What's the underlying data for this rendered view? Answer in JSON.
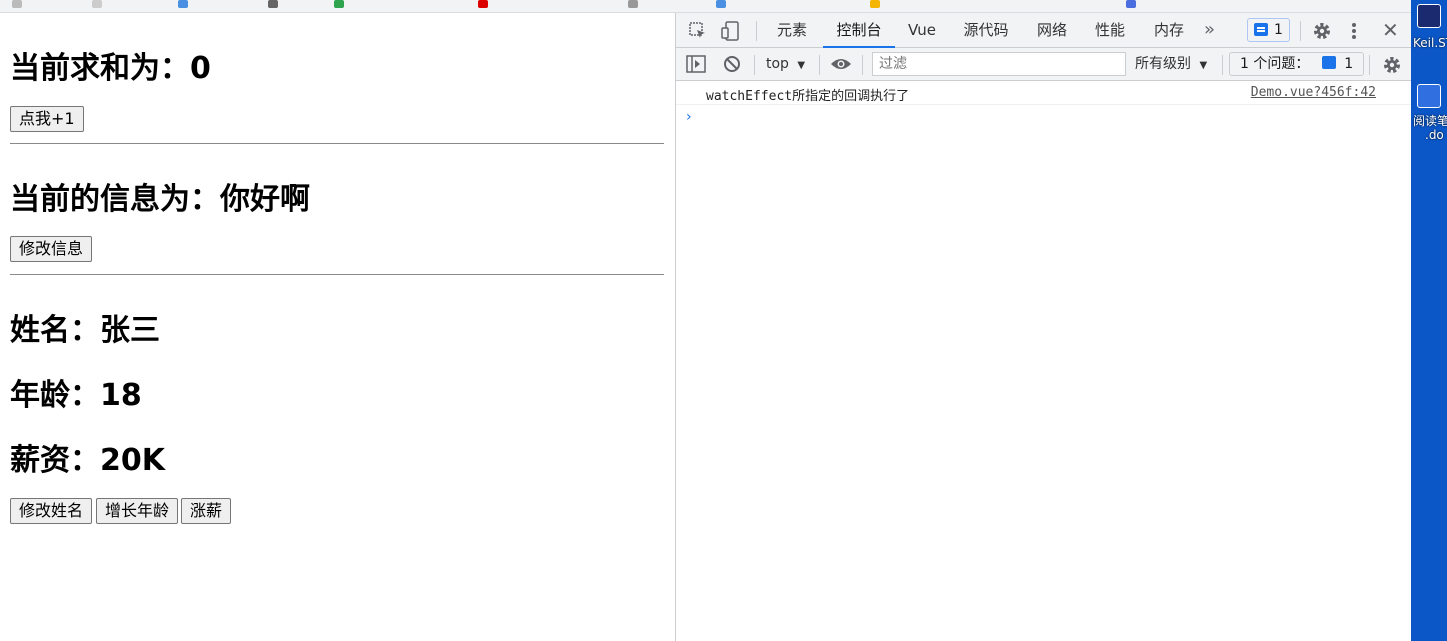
{
  "page": {
    "sum_heading": "当前求和为：0",
    "add_button": "点我+1",
    "msg_heading": "当前的信息为：你好啊",
    "edit_msg_button": "修改信息",
    "name_heading": "姓名：张三",
    "age_heading": "年龄：18",
    "salary_heading": "薪资：20K",
    "edit_name_button": "修改姓名",
    "grow_age_button": "增长年龄",
    "raise_button": "涨薪"
  },
  "devtools": {
    "tabs": [
      "元素",
      "控制台",
      "Vue",
      "源代码",
      "网络",
      "性能",
      "内存"
    ],
    "active_tab": "控制台",
    "more_tabs_icon": "chevron-double-right",
    "issues_badge": "1",
    "toolbar": {
      "context": "top",
      "filter_placeholder": "过滤",
      "levels": "所有级别",
      "issues_label": "1 个问题：",
      "issues_count": "1"
    },
    "console": {
      "message": "watchEffect所指定的回调执行了",
      "source": "Demo.vue?456f:42"
    }
  },
  "desktop": {
    "icon1_label": "Keil.ST",
    "icon2_label_1": "阅读笔",
    "icon2_label_2": ".do"
  },
  "colors": {
    "accent": "#1a73e8",
    "desktop_bg": "#0b57c8"
  }
}
